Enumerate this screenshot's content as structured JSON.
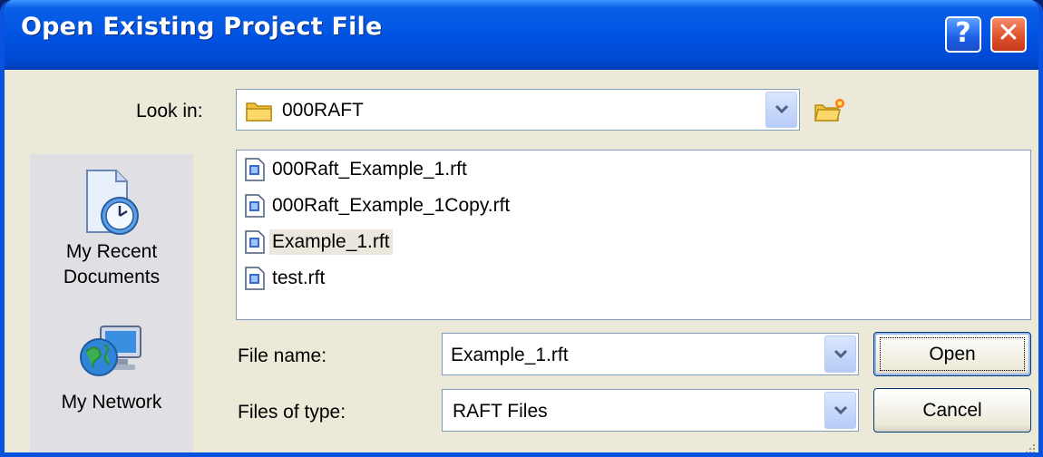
{
  "window": {
    "title": "Open Existing Project File",
    "help_label": "?",
    "close_label": "✕"
  },
  "look_in": {
    "label": "Look in:",
    "value": "000RAFT"
  },
  "places": [
    {
      "label_line1": "My Recent",
      "label_line2": "Documents",
      "icon": "recent-documents-icon"
    },
    {
      "label_line1": "My Network",
      "icon": "network-icon"
    }
  ],
  "files": [
    {
      "name": "000Raft_Example_1.rft",
      "selected": false
    },
    {
      "name": "000Raft_Example_1Copy.rft",
      "selected": false
    },
    {
      "name": "Example_1.rft",
      "selected": true
    },
    {
      "name": "test.rft",
      "selected": false
    }
  ],
  "file_name": {
    "label": "File name:",
    "value": "Example_1.rft"
  },
  "file_type": {
    "label": "Files of type:",
    "value": "RAFT Files"
  },
  "buttons": {
    "open": "Open",
    "cancel": "Cancel"
  },
  "colors": {
    "titlebar": "#0054e3",
    "dialog_bg": "#ece9d8",
    "places_bg": "#e0dfe3",
    "selection": "#ebe7dc"
  }
}
